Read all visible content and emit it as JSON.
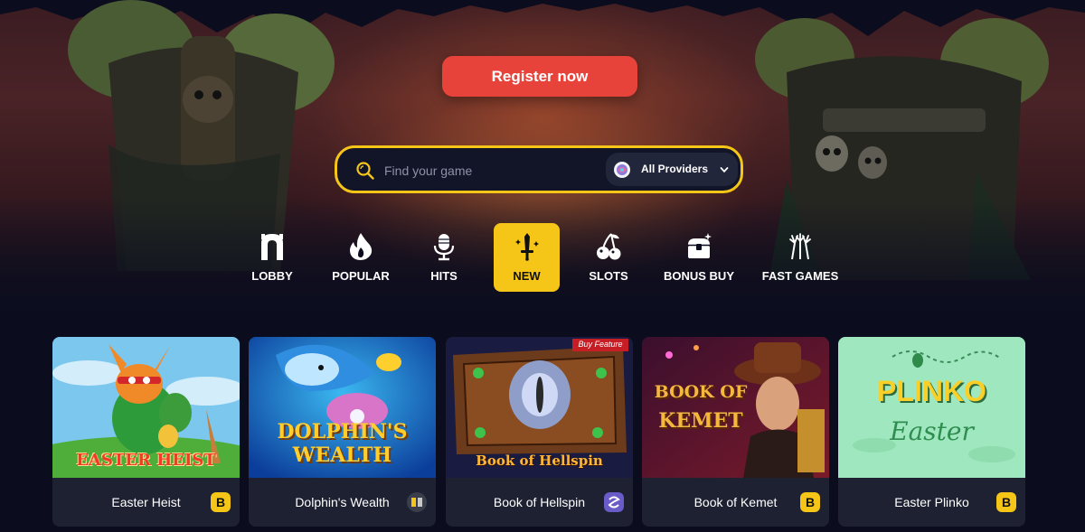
{
  "hero": {
    "register_label": "Register now"
  },
  "search": {
    "placeholder": "Find your game",
    "providers_label": "All Providers"
  },
  "categories": [
    {
      "label": "LOBBY",
      "icon": "arch-icon",
      "active": false
    },
    {
      "label": "POPULAR",
      "icon": "flame-icon",
      "active": false
    },
    {
      "label": "HITS",
      "icon": "microphone-icon",
      "active": false
    },
    {
      "label": "NEW",
      "icon": "sword-icon",
      "active": true
    },
    {
      "label": "SLOTS",
      "icon": "cherries-icon",
      "active": false
    },
    {
      "label": "BONUS BUY",
      "icon": "treasure-chest-icon",
      "active": false
    },
    {
      "label": "FAST GAMES",
      "icon": "fireworks-icon",
      "active": false
    }
  ],
  "games": [
    {
      "title": "Easter Heist",
      "thumb_text": "EASTER HEIST",
      "provider_icon": "bgaming-b-icon"
    },
    {
      "title": "Dolphin's Wealth",
      "thumb_text_1": "DOLPHIN'S",
      "thumb_text_2": "WEALTH",
      "provider_icon": "provider-logo-icon"
    },
    {
      "title": "Book of Hellspin",
      "thumb_text": "Book of Hellspin",
      "thumb_tag": "Buy Feature",
      "provider_icon": "spinomenal-icon"
    },
    {
      "title": "Book of Kemet",
      "thumb_text_1": "BOOK OF",
      "thumb_text_2": "KEMET",
      "provider_icon": "bgaming-b-icon"
    },
    {
      "title": "Easter Plinko",
      "thumb_text_1": "PLINKO",
      "thumb_text_2": "Easter",
      "provider_icon": "bgaming-b-icon"
    }
  ],
  "colors": {
    "accent_yellow": "#f5c518",
    "register_red": "#e8433b",
    "background": "#0b0d1e",
    "card_footer": "#1e2131"
  }
}
